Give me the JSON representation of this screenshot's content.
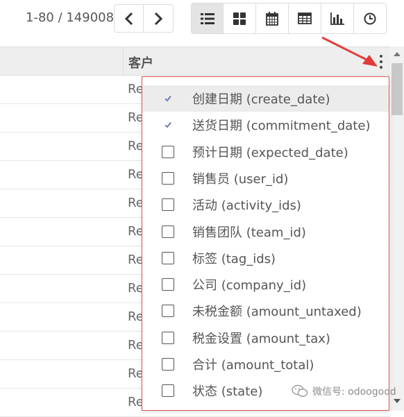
{
  "pager": {
    "text": "1-80 / 149008"
  },
  "nav": {
    "prev": "chevron-left",
    "next": "chevron-right"
  },
  "views": [
    "list",
    "kanban",
    "calendar",
    "pivot",
    "graph",
    "activity"
  ],
  "table": {
    "column_header": "客户",
    "rows": [
      "Re",
      "Re",
      "Re",
      "Re",
      "Re",
      "Re",
      "Re",
      "Re",
      "Re",
      "Re",
      "Re",
      "Re"
    ]
  },
  "dropdown": {
    "items": [
      {
        "label": "创建日期 (create_date)",
        "checked": true,
        "highlighted": true
      },
      {
        "label": "送货日期 (commitment_date)",
        "checked": true,
        "highlighted": false
      },
      {
        "label": "预计日期 (expected_date)",
        "checked": false
      },
      {
        "label": "销售员 (user_id)",
        "checked": false
      },
      {
        "label": "活动 (activity_ids)",
        "checked": false
      },
      {
        "label": "销售团队 (team_id)",
        "checked": false
      },
      {
        "label": "标签 (tag_ids)",
        "checked": false
      },
      {
        "label": "公司 (company_id)",
        "checked": false
      },
      {
        "label": "未税金额 (amount_untaxed)",
        "checked": false
      },
      {
        "label": "税金设置 (amount_tax)",
        "checked": false
      },
      {
        "label": "合计 (amount_total)",
        "checked": false
      },
      {
        "label": "状态 (state)",
        "checked": false
      }
    ]
  },
  "watermark": {
    "text": "微信号: odoogood"
  },
  "colors": {
    "accent_red": "#d9534f",
    "check": "#6b7bb5"
  }
}
